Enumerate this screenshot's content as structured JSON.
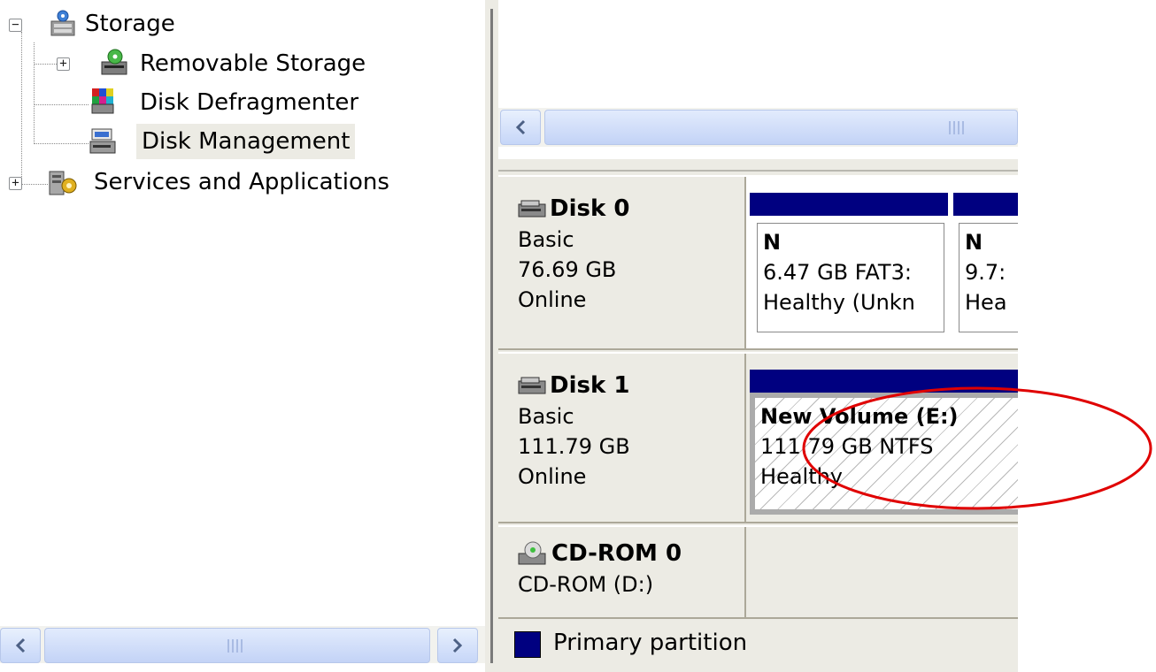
{
  "tree": {
    "items": [
      {
        "label": "Storage",
        "expander": "−",
        "icon": "storage-icon"
      },
      {
        "label": "Removable Storage",
        "expander": "+",
        "icon": "removable-storage-icon"
      },
      {
        "label": "Disk Defragmenter",
        "icon": "defragmenter-icon"
      },
      {
        "label": "Disk Management",
        "icon": "disk-management-icon",
        "selected": true
      },
      {
        "label": "Services and Applications",
        "expander": "+",
        "icon": "services-icon"
      }
    ]
  },
  "disks": [
    {
      "name": "Disk 0",
      "type": "Basic",
      "size": "76.69 GB",
      "status": "Online",
      "partitions": [
        {
          "label": "N",
          "size_fs": "6.47 GB FAT3:",
          "status": "Healthy (Unkn"
        },
        {
          "label": "N",
          "size_fs": "9.7:",
          "status": "Hea"
        }
      ]
    },
    {
      "name": "Disk 1",
      "type": "Basic",
      "size": "111.79 GB",
      "status": "Online",
      "partitions": [
        {
          "label": "New Volume  (E:)",
          "size_fs": "111.79 GB NTFS",
          "status": "Healthy"
        }
      ]
    },
    {
      "name": "CD-ROM 0",
      "type": "CD-ROM (D:)"
    }
  ],
  "legend": {
    "label": "Primary partition",
    "color": "#000080"
  },
  "colors": {
    "primary_partition": "#000080",
    "highlight": "#e00000",
    "panel": "#ecebe4"
  }
}
